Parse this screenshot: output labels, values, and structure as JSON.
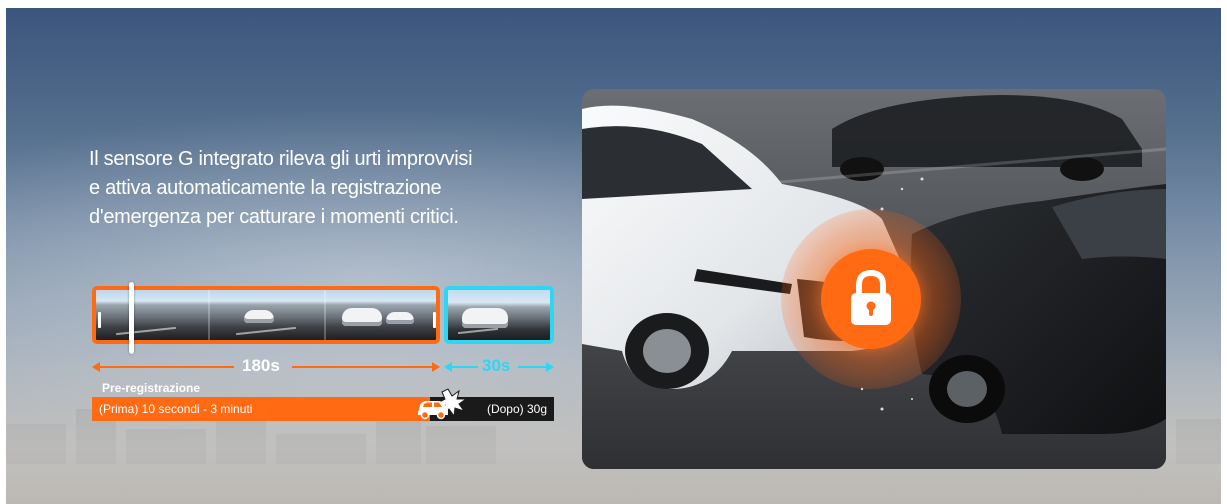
{
  "headline": {
    "lines": [
      "Il sensore G integrato rileva gli urti improvvisi",
      "e attiva automaticamente la registrazione",
      "d'emergenza per catturare i momenti critici."
    ]
  },
  "timeline": {
    "pre_duration": "180s",
    "post_duration": "30s",
    "pre_label": "Pre-registrazione",
    "pre_bar_text": "(Prima) 10 secondi - 3 minuti",
    "post_bar_text": "(Dopo) 30g"
  },
  "icons": {
    "crash": "car-crash-icon",
    "lock": "lock-icon"
  },
  "colors": {
    "accent_orange": "#ff6a13",
    "accent_cyan": "#2fd6f2",
    "bar_dark": "#1a1a1a"
  }
}
